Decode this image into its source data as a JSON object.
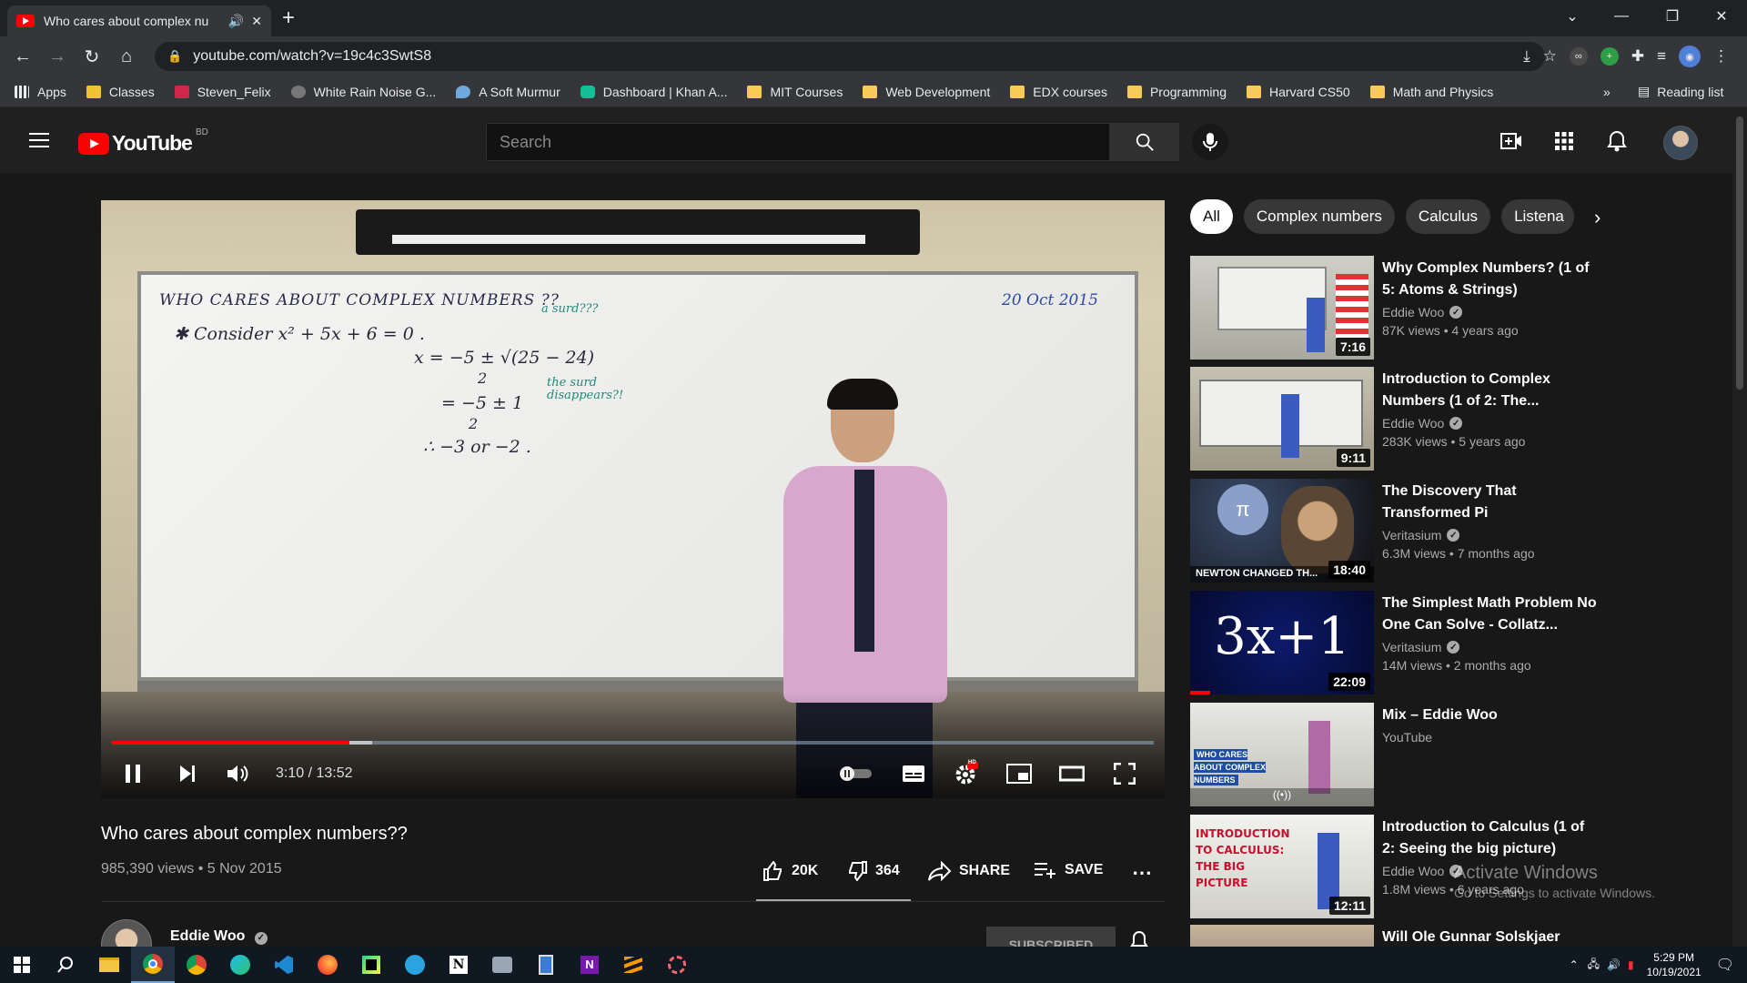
{
  "browser": {
    "tab_title": "Who cares about complex nu",
    "url": "youtube.com/watch?v=19c4c3SwtS8",
    "bookmarks": [
      "Apps",
      "Classes",
      "Steven_Felix",
      "White Rain Noise G...",
      "A Soft Murmur",
      "Dashboard | Khan A...",
      "MIT Courses",
      "Web Development",
      "EDX courses",
      "Programming",
      "Harvard CS50",
      "Math and Physics"
    ],
    "overflow": "»",
    "reading_list": "Reading list"
  },
  "youtube": {
    "logo_text": "YouTube",
    "country_code": "BD",
    "search_placeholder": "Search"
  },
  "player": {
    "time": "3:10 / 13:52",
    "progress_fraction": 0.228,
    "buffered_fraction": 0.25,
    "hd_badge": "HD",
    "board": {
      "title": "WHO CARES ABOUT COMPLEX NUMBERS ??",
      "date": "20 Oct 2015",
      "line1": "✱ Consider   x² + 5x + 6 = 0 .",
      "line2": "x = −5 ± √(25 − 24)",
      "line2b": "2",
      "line3": "= −5 ± 1",
      "line3b": "2",
      "line4": "∴ −3 or −2 .",
      "note1": "a surd???",
      "note2": "the surd disappears?!"
    }
  },
  "video": {
    "title": "Who cares about complex numbers??",
    "stats": "985,390 views • 5 Nov 2015",
    "likes": "20K",
    "dislikes": "364",
    "share": "SHARE",
    "save": "SAVE",
    "channel": "Eddie Woo",
    "subscribe": "SUBSCRIBED"
  },
  "chips": [
    "All",
    "Complex numbers",
    "Calculus",
    "Listena"
  ],
  "recommendations": [
    {
      "title": "Why Complex Numbers? (1 of 5: Atoms & Strings)",
      "channel": "Eddie Woo",
      "verified": true,
      "meta": "87K views • 4 years ago",
      "duration": "7:16"
    },
    {
      "title": "Introduction to Complex Numbers (1 of 2: The...",
      "channel": "Eddie Woo",
      "verified": true,
      "meta": "283K views • 5 years ago",
      "duration": "9:11"
    },
    {
      "title": "The Discovery That Transformed Pi",
      "channel": "Veritasium",
      "verified": true,
      "meta": "6.3M views • 7 months ago",
      "duration": "18:40",
      "thumb_text": "NEWTON CHANGED TH..."
    },
    {
      "title": "The Simplest Math Problem No One Can Solve - Collatz...",
      "channel": "Veritasium",
      "verified": true,
      "meta": "14M views • 2 months ago",
      "duration": "22:09",
      "thumb_text": "3x+1"
    },
    {
      "title": "Mix – Eddie Woo",
      "channel": "YouTube",
      "verified": false,
      "meta": "",
      "duration": "",
      "thumb_text": "WHO CARES ABOUT COMPLEX NUMBERS"
    },
    {
      "title": "Introduction to Calculus (1 of 2: Seeing the big picture)",
      "channel": "Eddie Woo",
      "verified": true,
      "meta": "1.8M views • 6 years ago",
      "duration": "12:11",
      "thumb_text": "INTRODUCTION TO CALCULUS: THE BIG PICTURE"
    },
    {
      "title": "Will Ole Gunnar Solskjaer",
      "channel": "",
      "verified": false,
      "meta": "",
      "duration": ""
    }
  ],
  "watermark": {
    "line1": "Activate Windows",
    "line2": "Go to Settings to activate Windows."
  },
  "taskbar": {
    "time": "5:29 PM",
    "date": "10/19/2021"
  },
  "colors": {
    "accent_red": "#ff0000",
    "bg": "#181818",
    "header": "#202020"
  }
}
